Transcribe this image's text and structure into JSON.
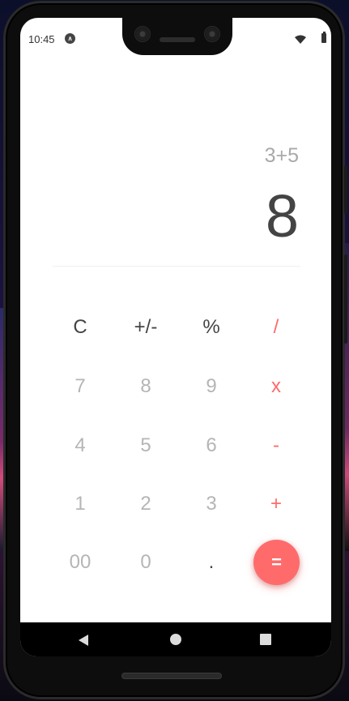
{
  "status_bar": {
    "time": "10:45",
    "app_icon_glyph": "∧",
    "icons": [
      "expo-app-icon",
      "wifi-icon",
      "battery-icon"
    ]
  },
  "display": {
    "expression": "3+5",
    "result": "8"
  },
  "keypad": {
    "row1": [
      "C",
      "+/-",
      "%",
      "/"
    ],
    "row2": [
      "7",
      "8",
      "9",
      "x"
    ],
    "row3": [
      "4",
      "5",
      "6",
      "-"
    ],
    "row4": [
      "1",
      "2",
      "3",
      "+"
    ],
    "row5": [
      "00",
      "0",
      ".",
      "="
    ]
  },
  "nav_bar": {
    "buttons": [
      "back-icon",
      "home-icon",
      "recents-icon"
    ]
  },
  "colors": {
    "accent": "#ff6b6b",
    "function_text": "#444444",
    "number_text": "#b5b5b5",
    "expression_text": "#a9a9a9",
    "result_text": "#444444"
  }
}
